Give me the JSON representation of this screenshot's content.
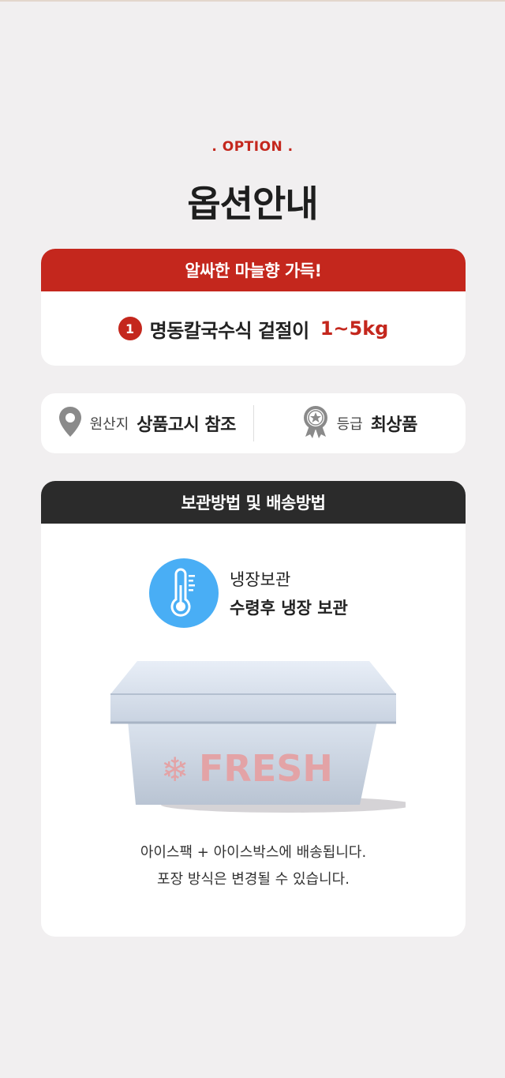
{
  "header": {
    "eyebrow": ". OPTION .",
    "title": "옵션안내"
  },
  "option_card": {
    "banner": "알싸한 마늘향 가득!",
    "items": [
      {
        "number": "1",
        "name": "명동칼국수식 겉절이",
        "weight": "1~5kg"
      }
    ]
  },
  "info": {
    "origin_label": "원산지",
    "origin_value": "상품고시 참조",
    "grade_label": "등급",
    "grade_value": "최상품"
  },
  "storage": {
    "banner": "보관방법 및 배송방법",
    "line1": "냉장보관",
    "line2": "수령후 냉장 보관",
    "box_text": "FRESH",
    "note1": "아이스팩 + 아이스박스에 배송됩니다.",
    "note2": "포장 방식은 변경될 수 있습니다."
  },
  "colors": {
    "accent_red": "#c4271d",
    "dark_banner": "#2b2b2b",
    "thermo_blue": "#49aef5",
    "background": "#f1eff0"
  },
  "icons": [
    "map-pin-icon",
    "award-badge-icon",
    "thermometer-icon",
    "snowflake-icon"
  ]
}
